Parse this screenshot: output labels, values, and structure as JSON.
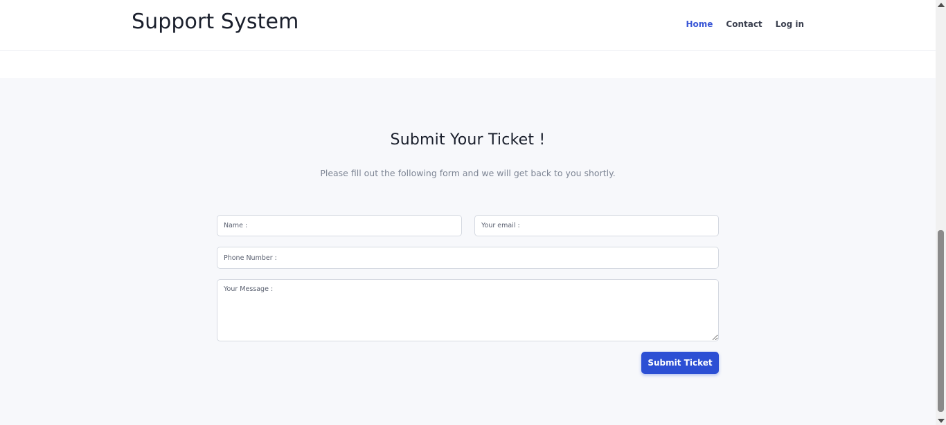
{
  "header": {
    "brand": "Support System",
    "nav": [
      {
        "label": "Home",
        "active": true
      },
      {
        "label": "Contact",
        "active": false
      },
      {
        "label": "Log in",
        "active": false
      }
    ]
  },
  "form": {
    "title": "Submit Your Ticket !",
    "subtitle": "Please fill out the following form and we will get back to you shortly.",
    "name_placeholder": "Name :",
    "email_placeholder": "Your email :",
    "phone_placeholder": "Phone Number :",
    "message_placeholder": "Your Message :",
    "submit_label": "Submit Ticket"
  },
  "colors": {
    "accent": "#2c4fd4",
    "nav_active": "#3a57d6",
    "section_bg": "#f7f8fb"
  }
}
